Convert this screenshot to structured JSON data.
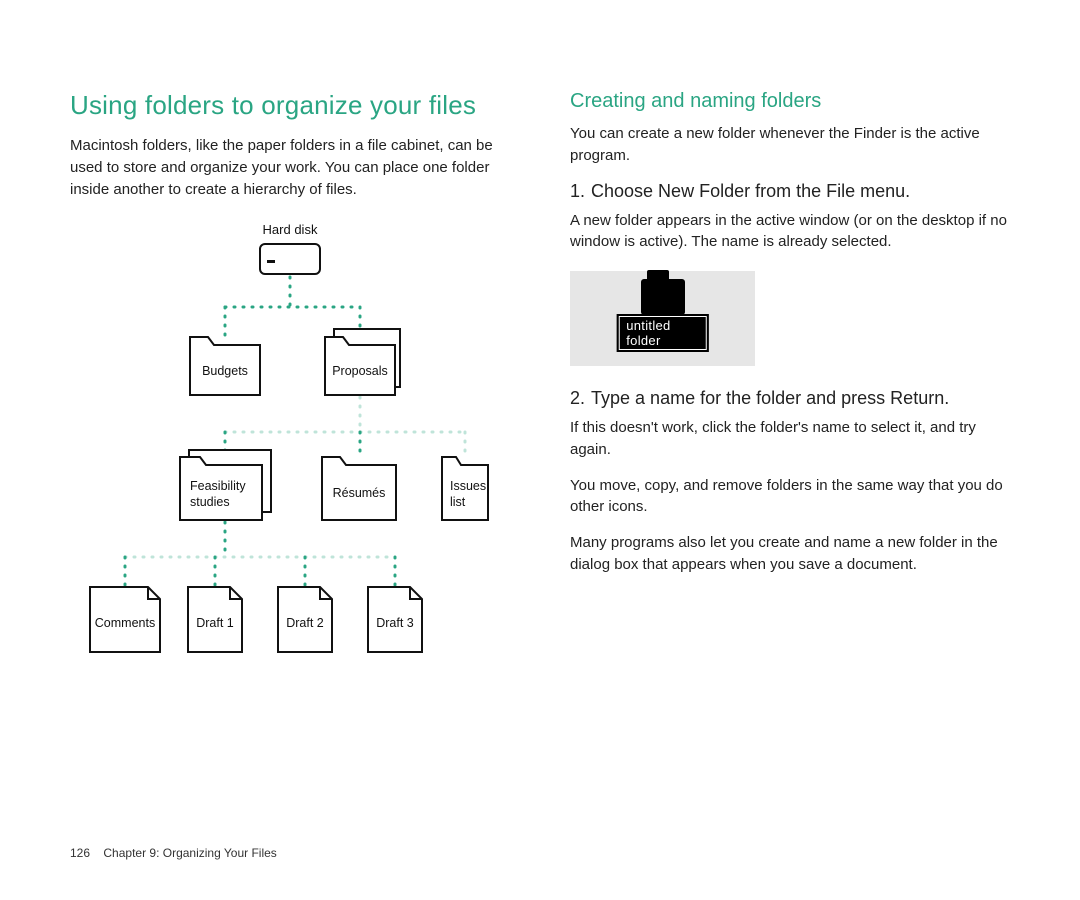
{
  "left": {
    "heading": "Using folders to organize your files",
    "intro": "Macintosh folders, like the paper folders in a file cabinet, can be used to store and organize your work. You can place one folder inside another to create a hierarchy of files.",
    "tree": {
      "root": "Hard disk",
      "level1": [
        "Budgets",
        "Proposals"
      ],
      "level2": [
        "Feasibility studies",
        "Résumés",
        "Issues list"
      ],
      "level3": [
        "Comments",
        "Draft 1",
        "Draft 2",
        "Draft 3"
      ]
    }
  },
  "right": {
    "heading": "Creating and naming folders",
    "intro": "You can create a new folder whenever the Finder is the active program.",
    "step1_title": "Choose New Folder from the File menu.",
    "step1_body": "A new folder appears in the active window (or on the desktop if no window is active). The name is already selected.",
    "untitled_label": "untitled folder",
    "step2_title": "Type a name for the folder and press Return.",
    "step2_body": "If this doesn't work, click the folder's name to select it, and try again.",
    "para_move": "You move, copy, and remove folders in the same way that you do other icons.",
    "para_dialog": "Many programs also let you create and name a new folder in the dialog box that appears when you save a document."
  },
  "footer": {
    "page": "126",
    "chapter": "Chapter 9: Organizing Your Files"
  },
  "accent": "#2aa583"
}
